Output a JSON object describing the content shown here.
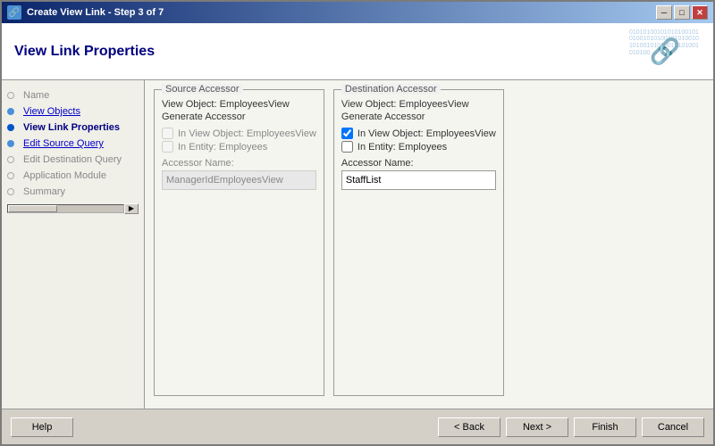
{
  "window": {
    "title": "Create View Link - Step 3 of 7",
    "close_btn": "✕",
    "minimize_btn": "─",
    "maximize_btn": "□"
  },
  "header": {
    "title": "View Link Properties",
    "bg_text": "010101001010101001010100101010010101001010100101010010101001010100"
  },
  "sidebar": {
    "items": [
      {
        "id": "name",
        "label": "Name",
        "state": "empty"
      },
      {
        "id": "view-objects",
        "label": "View Objects",
        "state": "done"
      },
      {
        "id": "view-link-properties",
        "label": "View Link Properties",
        "state": "active"
      },
      {
        "id": "edit-source-query",
        "label": "Edit Source Query",
        "state": "done"
      },
      {
        "id": "edit-destination-query",
        "label": "Edit Destination Query",
        "state": "empty"
      },
      {
        "id": "application-module",
        "label": "Application Module",
        "state": "empty"
      },
      {
        "id": "summary",
        "label": "Summary",
        "state": "empty"
      }
    ]
  },
  "source_accessor": {
    "title": "Source Accessor",
    "view_object_label": "View Object: EmployeesView",
    "generate_accessor_label": "Generate Accessor",
    "in_view_object_checkbox": {
      "label": "In View Object: EmployeesView",
      "checked": false
    },
    "in_entity_checkbox": {
      "label": "In Entity: Employees",
      "checked": false
    },
    "accessor_name_label": "Accessor Name:",
    "accessor_name_value": "ManagerIdEmployeesView",
    "disabled": true
  },
  "destination_accessor": {
    "title": "Destination Accessor",
    "view_object_label": "View Object: EmployeesView",
    "generate_accessor_label": "Generate Accessor",
    "in_view_object_checkbox": {
      "label": "In View Object: EmployeesView",
      "checked": true
    },
    "in_entity_checkbox": {
      "label": "In Entity: Employees",
      "checked": false
    },
    "accessor_name_label": "Accessor Name:",
    "accessor_name_value": "StaffList",
    "disabled": false
  },
  "footer": {
    "help_label": "Help",
    "back_label": "< Back",
    "next_label": "Next >",
    "finish_label": "Finish",
    "cancel_label": "Cancel"
  }
}
